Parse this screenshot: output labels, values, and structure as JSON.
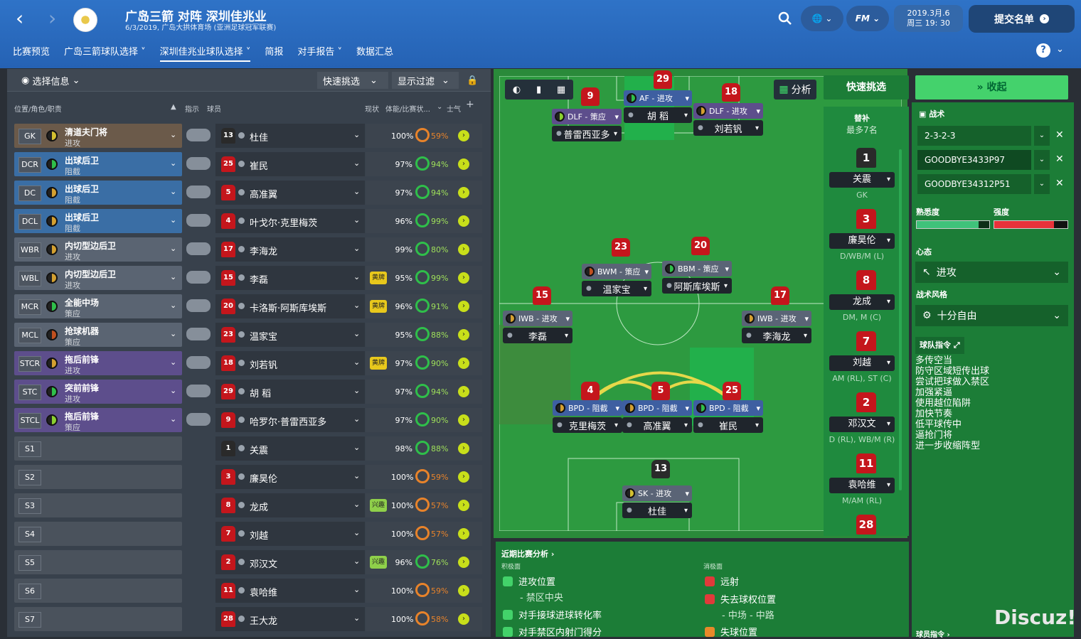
{
  "header": {
    "title": "广岛三箭 对阵 深圳佳兆业",
    "subtitle": "6/3/2019, 广岛大拱体育场 (亚洲足球冠军联赛)",
    "fm": "FM",
    "date_line1": "2019.3月.6",
    "date_line2": "周三 19: 30",
    "submit": "提交名单"
  },
  "tabs": [
    "比赛预览",
    "广岛三箭球队选择",
    "深圳佳兆业球队选择",
    "简报",
    "对手报告",
    "数据汇总"
  ],
  "left": {
    "select_info": "选择信息",
    "quick_pick": "快速挑选",
    "filter": "显示过滤",
    "cols": {
      "pos": "位置/角色/职责",
      "instr": "指示",
      "player": "球员",
      "status": "现状",
      "fitness": "体能/比赛状...",
      "morale": "士气"
    }
  },
  "rows": [
    {
      "pos": "GK",
      "role": "清道夫门将",
      "duty": "进攻",
      "num": "13",
      "name": "杜佳",
      "card": "",
      "fit": "100%",
      "cond": "59%",
      "rc": "#6b5a4a",
      "circ": "#d4c030"
    },
    {
      "pos": "DCR",
      "role": "出球后卫",
      "duty": "阻截",
      "num": "25",
      "name": "崔民",
      "card": "",
      "fit": "97%",
      "cond": "94%",
      "rc": "#3a6ea5",
      "circ": "#2fbf4a"
    },
    {
      "pos": "DC",
      "role": "出球后卫",
      "duty": "阻截",
      "num": "5",
      "name": "高准翼",
      "card": "",
      "fit": "97%",
      "cond": "94%",
      "rc": "#3a6ea5",
      "circ": "#d4a030"
    },
    {
      "pos": "DCL",
      "role": "出球后卫",
      "duty": "阻截",
      "num": "4",
      "name": "叶戈尔·克里梅茨",
      "card": "",
      "fit": "96%",
      "cond": "99%",
      "rc": "#3a6ea5",
      "circ": "#d4a030"
    },
    {
      "pos": "WBR",
      "role": "内切型边后卫",
      "duty": "进攻",
      "num": "17",
      "name": "李海龙",
      "card": "",
      "fit": "99%",
      "cond": "80%",
      "rc": "#5a6472",
      "circ": "#d4a030"
    },
    {
      "pos": "WBL",
      "role": "内切型边后卫",
      "duty": "进攻",
      "num": "15",
      "name": "李磊",
      "card": "黄牌",
      "fit": "95%",
      "cond": "99%",
      "rc": "#5a6472",
      "circ": "#d4a030"
    },
    {
      "pos": "MCR",
      "role": "全能中场",
      "duty": "策应",
      "num": "20",
      "name": "卡洛斯·阿斯库埃斯",
      "card": "黄牌",
      "fit": "96%",
      "cond": "91%",
      "rc": "#5a6472",
      "circ": "#2fbf4a"
    },
    {
      "pos": "MCL",
      "role": "抢球机器",
      "duty": "策应",
      "num": "23",
      "name": "温家宝",
      "card": "",
      "fit": "95%",
      "cond": "88%",
      "rc": "#5a6472",
      "circ": "#c05020"
    },
    {
      "pos": "STCR",
      "role": "拖后前锋",
      "duty": "进攻",
      "num": "18",
      "name": "刘若钒",
      "card": "黄牌",
      "fit": "97%",
      "cond": "90%",
      "rc": "#5d4e8c",
      "circ": "#d4a030"
    },
    {
      "pos": "STC",
      "role": "突前前锋",
      "duty": "进攻",
      "num": "29",
      "name": "胡 稻",
      "card": "",
      "fit": "97%",
      "cond": "94%",
      "rc": "#5d4e8c",
      "circ": "#2fbf4a"
    },
    {
      "pos": "STCL",
      "role": "拖后前锋",
      "duty": "策应",
      "num": "9",
      "name": "哈罗尔·普雷西亚多",
      "card": "",
      "fit": "97%",
      "cond": "90%",
      "rc": "#5d4e8c",
      "circ": "#8bd030"
    },
    {
      "pos": "S1",
      "role": "",
      "duty": "",
      "num": "1",
      "name": "关震",
      "card": "",
      "fit": "98%",
      "cond": "88%",
      "rc": "",
      "circ": ""
    },
    {
      "pos": "S2",
      "role": "",
      "duty": "",
      "num": "3",
      "name": "廉昊伦",
      "card": "",
      "fit": "100%",
      "cond": "59%",
      "rc": "",
      "circ": ""
    },
    {
      "pos": "S3",
      "role": "",
      "duty": "",
      "num": "8",
      "name": "龙成",
      "card": "兴趣",
      "fit": "100%",
      "cond": "57%",
      "rc": "",
      "circ": ""
    },
    {
      "pos": "S4",
      "role": "",
      "duty": "",
      "num": "7",
      "name": "刘越",
      "card": "",
      "fit": "100%",
      "cond": "57%",
      "rc": "",
      "circ": ""
    },
    {
      "pos": "S5",
      "role": "",
      "duty": "",
      "num": "2",
      "name": "邓汉文",
      "card": "兴趣",
      "fit": "96%",
      "cond": "76%",
      "rc": "",
      "circ": ""
    },
    {
      "pos": "S6",
      "role": "",
      "duty": "",
      "num": "11",
      "name": "袁哈维",
      "card": "",
      "fit": "100%",
      "cond": "59%",
      "rc": "",
      "circ": ""
    },
    {
      "pos": "S7",
      "role": "",
      "duty": "",
      "num": "28",
      "name": "王大龙",
      "card": "",
      "fit": "100%",
      "cond": "58%",
      "rc": "",
      "circ": ""
    }
  ],
  "pitch": {
    "analysis": "分析",
    "players": [
      {
        "num": "29",
        "role": "AF - 进攻",
        "name": "胡 稻",
        "c": "#2fbf4a",
        "cls": "blue"
      },
      {
        "num": "9",
        "role": "DLF - 策应",
        "name": "普雷西亚多",
        "c": "#8bd030",
        "cls": "purple"
      },
      {
        "num": "18",
        "role": "DLF - 进攻",
        "name": "刘若钒",
        "c": "#d4a030",
        "cls": "purple"
      },
      {
        "num": "23",
        "role": "BWM - 策应",
        "name": "温家宝",
        "c": "#c05020",
        "cls": ""
      },
      {
        "num": "20",
        "role": "BBM - 策应",
        "name": "阿斯库埃斯",
        "c": "#2fbf4a",
        "cls": ""
      },
      {
        "num": "15",
        "role": "IWB - 进攻",
        "name": "李磊",
        "c": "#d4a030",
        "cls": ""
      },
      {
        "num": "17",
        "role": "IWB - 进攻",
        "name": "李海龙",
        "c": "#d4a030",
        "cls": ""
      },
      {
        "num": "4",
        "role": "BPD - 阻截",
        "name": "克里梅茨",
        "c": "#d4a030",
        "cls": "blue"
      },
      {
        "num": "5",
        "role": "BPD - 阻截",
        "name": "高准翼",
        "c": "#d4a030",
        "cls": "blue"
      },
      {
        "num": "25",
        "role": "BPD - 阻截",
        "name": "崔民",
        "c": "#2fbf4a",
        "cls": "blue"
      },
      {
        "num": "13",
        "role": "SK - 进攻",
        "name": "杜佳",
        "c": "#d4c030",
        "cls": ""
      }
    ]
  },
  "subs": {
    "quick": "快速挑选",
    "title": "替补",
    "max": "最多7名",
    "list": [
      {
        "num": "1",
        "name": "关震",
        "pos": "GK"
      },
      {
        "num": "3",
        "name": "廉昊伦",
        "pos": "D/WB/M (L)"
      },
      {
        "num": "8",
        "name": "龙成",
        "pos": "DM, M (C)"
      },
      {
        "num": "7",
        "name": "刘越",
        "pos": "AM (RL), ST (C)"
      },
      {
        "num": "2",
        "name": "邓汉文",
        "pos": "D (RL), WB/M (R)"
      },
      {
        "num": "11",
        "name": "袁哈维",
        "pos": "M/AM (RL)"
      },
      {
        "num": "28",
        "name": "",
        "pos": ""
      }
    ]
  },
  "right": {
    "collapse": "收起",
    "tactic": "战术",
    "tactics": [
      "2-3-2-3",
      "GOODBYE3433P97",
      "GOODBYE34312P51"
    ],
    "familiarity": "熟悉度",
    "intensity": "强度",
    "familiarity_level": 0.85,
    "intensity_level": 0.82,
    "mentality_label": "心态",
    "mentality": "进攻",
    "style_label": "战术风格",
    "style": "十分自由",
    "instr_label": "球队指令",
    "instructions": [
      "多传空当",
      "防守区域短传出球",
      "尝试把球做入禁区",
      "加强紧逼",
      "使用越位陷阱",
      "加快节奏",
      "低平球传中",
      "逼抢门将",
      "进一步收缩阵型"
    ]
  },
  "analysis": {
    "title": "近期比赛分析 ›",
    "pos_label": "积极面",
    "neg_label": "消极面",
    "pos": [
      "进攻位置",
      "- 禁区中央",
      "对手接球进球转化率",
      "对手禁区内射门得分"
    ],
    "neg": [
      "远射",
      "失去球权位置",
      "- 中场 - 中路",
      "失球位置"
    ],
    "player_instr": "球员指令 ›"
  },
  "watermark": "Discuz!"
}
